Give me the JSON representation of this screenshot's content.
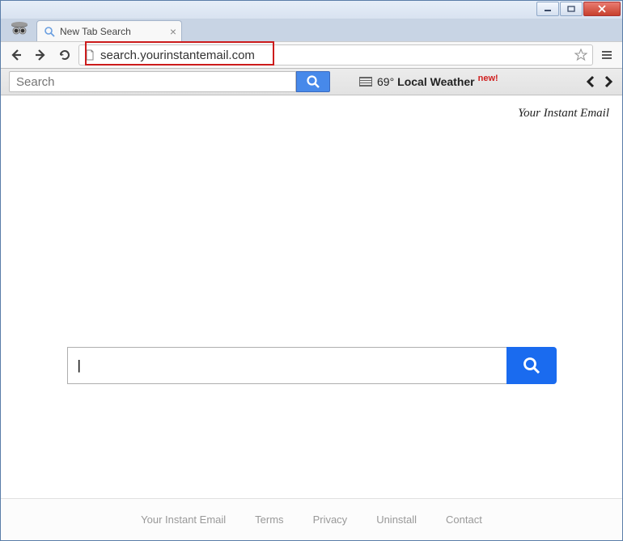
{
  "window": {
    "minimize_aria": "Minimize",
    "maximize_aria": "Maximize",
    "close_aria": "Close"
  },
  "tab": {
    "title": "New Tab Search"
  },
  "address": {
    "url": "search.yourinstantemail.com"
  },
  "extbar": {
    "search_placeholder": "Search",
    "weather_temp": "69°",
    "weather_label": "Local Weather",
    "new_tag": "new!"
  },
  "page": {
    "brand": "Your Instant Email",
    "main_search_value": "|"
  },
  "footer": {
    "links": {
      "brand": "Your Instant Email",
      "terms": "Terms",
      "privacy": "Privacy",
      "uninstall": "Uninstall",
      "contact": "Contact"
    }
  }
}
